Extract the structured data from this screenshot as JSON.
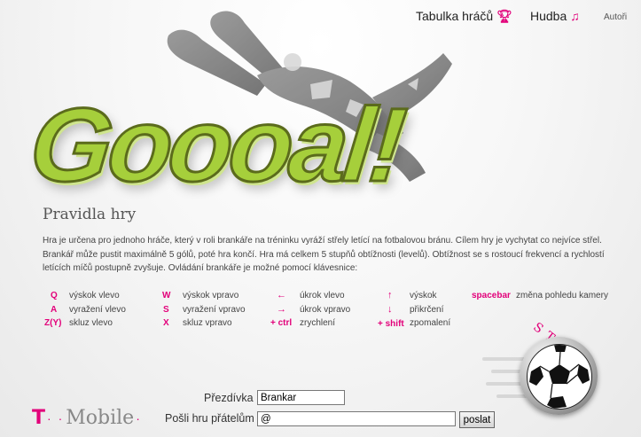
{
  "nav": {
    "leaderboard_label": "Tabulka hráčů",
    "music_label": "Hudba",
    "authors_label": "Autoři"
  },
  "game": {
    "title": "Goooal!"
  },
  "rules": {
    "heading": "Pravidla hry",
    "text": "Hra je určena pro jednoho hráče, který v roli brankáře na tréninku vyráží střely letící na fotbalovou bránu. Cílem hry je vychytat co nejvíce střel. Brankář může pustit maximálně 5 gólů, poté hra končí. Hra má celkem 5 stupňů obtížnosti (levelů). Obtížnost se s rostoucí frekvencí a rychlostí letících míčů postupně zvyšuje. Ovládání brankáře je možné pomocí klávesnice:"
  },
  "controls": [
    {
      "key": "Q",
      "desc": "výskok vlevo"
    },
    {
      "key": "A",
      "desc": "vyražení vlevo"
    },
    {
      "key": "Z(Y)",
      "desc": "skluz vlevo"
    },
    {
      "key": "W",
      "desc": "výskok vpravo"
    },
    {
      "key": "S",
      "desc": "vyražení vpravo"
    },
    {
      "key": "X",
      "desc": "skluz vpravo"
    },
    {
      "key": "←",
      "desc": "úkrok vlevo"
    },
    {
      "key": "→",
      "desc": "úkrok vpravo"
    },
    {
      "key": "+ ctrl",
      "desc": "zrychlení"
    },
    {
      "key": "↑",
      "desc": "výskok"
    },
    {
      "key": "↓",
      "desc": "přikrčení"
    },
    {
      "key": "+ shift",
      "desc": "zpomalení"
    },
    {
      "key": "spacebar",
      "desc": "změna pohledu kamery"
    }
  ],
  "start": {
    "label": "START"
  },
  "brand": {
    "t": "T",
    "dots": "· ·",
    "word": "Mobile",
    "dot_end": "·"
  },
  "form": {
    "nickname_label": "Přezdívka",
    "nickname_value": "Brankar",
    "send_label": "Pošli hru přátelům",
    "email_value": "@",
    "send_button": "poslat"
  }
}
